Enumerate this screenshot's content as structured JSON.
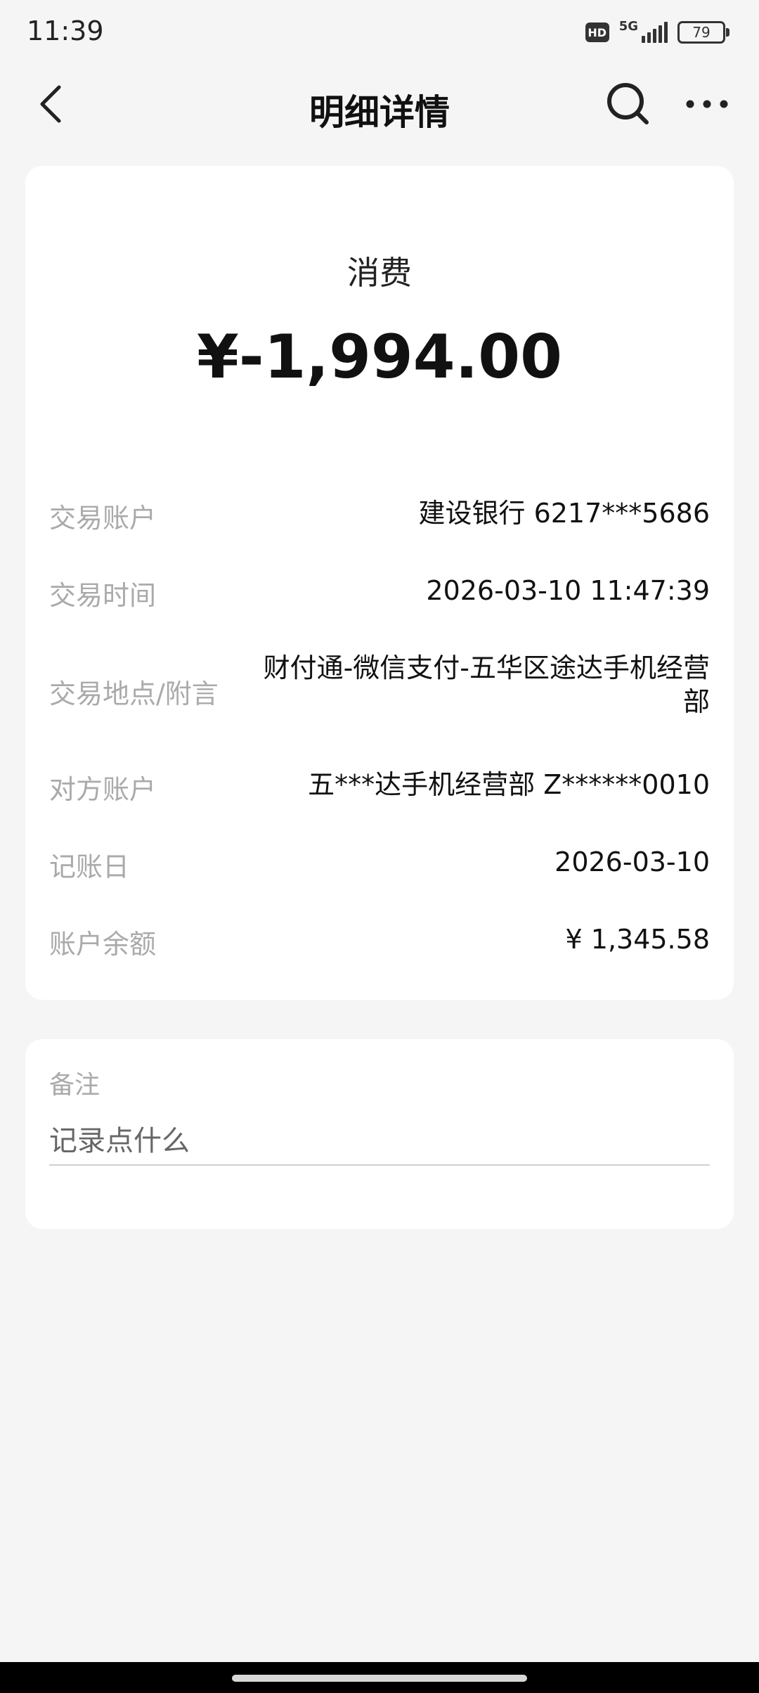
{
  "status_bar": {
    "time": "11:39",
    "hd_label": "HD",
    "network": "5G",
    "battery": "79"
  },
  "nav": {
    "title": "明细详情",
    "back_icon": "chevron-left-icon",
    "search_icon": "search-icon",
    "more_icon": "more-dots-icon"
  },
  "transaction": {
    "type": "消费",
    "amount": "¥-1,994.00",
    "details": [
      {
        "label": "交易账户",
        "value": "建设银行 6217***5686"
      },
      {
        "label": "交易时间",
        "value": "2026-03-10 11:47:39"
      },
      {
        "label": "交易地点/附言",
        "value": "财付通-微信支付-五华区途达手机经营部"
      },
      {
        "label": "对方账户",
        "value": "五***达手机经营部 Z******0010"
      },
      {
        "label": "记账日",
        "value": "2026-03-10"
      },
      {
        "label": "账户余额",
        "value": "¥ 1,345.58"
      }
    ]
  },
  "remark": {
    "label": "备注",
    "placeholder": "记录点什么"
  },
  "colors": {
    "background": "#f5f5f5",
    "card": "#ffffff",
    "label_text": "#aaaaaa",
    "value_text": "#111111"
  }
}
